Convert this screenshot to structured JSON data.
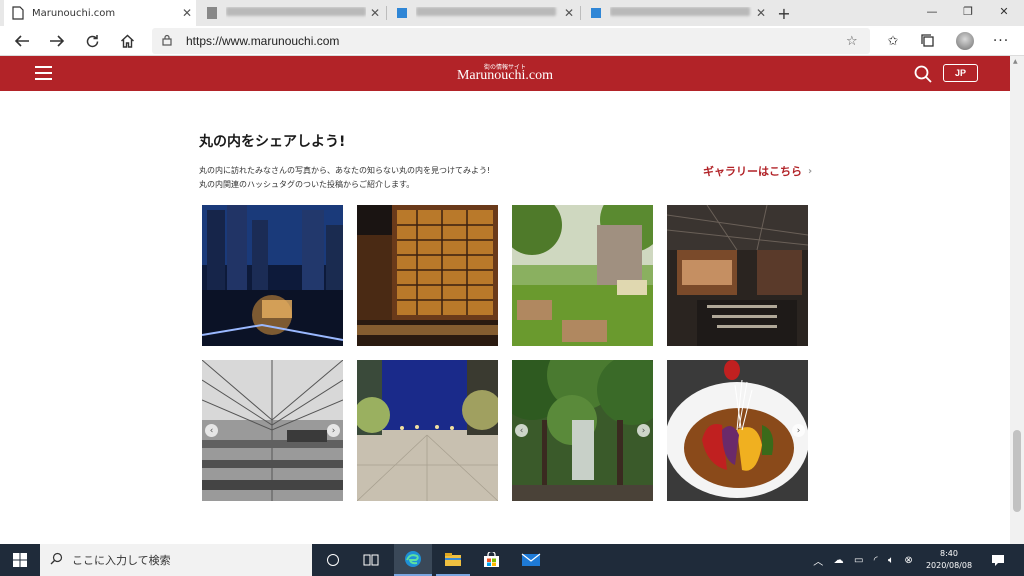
{
  "browser": {
    "tabs": [
      {
        "title": "Marunouchi.com",
        "active": true
      },
      {
        "title": "",
        "active": false
      },
      {
        "title": "",
        "active": false
      },
      {
        "title": "",
        "active": false
      }
    ],
    "new_tab_label": "+",
    "url": "https://www.marunouchi.com",
    "window_controls": {
      "minimize": "—",
      "maximize": "❐",
      "close": "✕"
    }
  },
  "site": {
    "logo_small": "街の情報サイト",
    "logo_main": "Marunouchi.com",
    "lang_button": "JP",
    "brand_color": "#b22328"
  },
  "content": {
    "title": "丸の内をシェアしよう!",
    "desc_line1": "丸の内に訪れたみなさんの写真から、あなたの知らない丸の内を見つけてみよう!",
    "desc_line2": "丸の内関連のハッシュタグのついた投稿からご紹介します。",
    "gallery_link": "ギャラリーはこちら",
    "photos": [
      {
        "name": "photo-night-skyline"
      },
      {
        "name": "photo-lit-building"
      },
      {
        "name": "photo-green-plaza"
      },
      {
        "name": "photo-covered-market"
      },
      {
        "name": "photo-glass-atrium"
      },
      {
        "name": "photo-night-avenue"
      },
      {
        "name": "photo-tree-lined-street"
      },
      {
        "name": "photo-food-dish"
      }
    ]
  },
  "taskbar": {
    "search_placeholder": "ここに入力して検索",
    "time": "8:40",
    "date": "2020/08/08"
  }
}
